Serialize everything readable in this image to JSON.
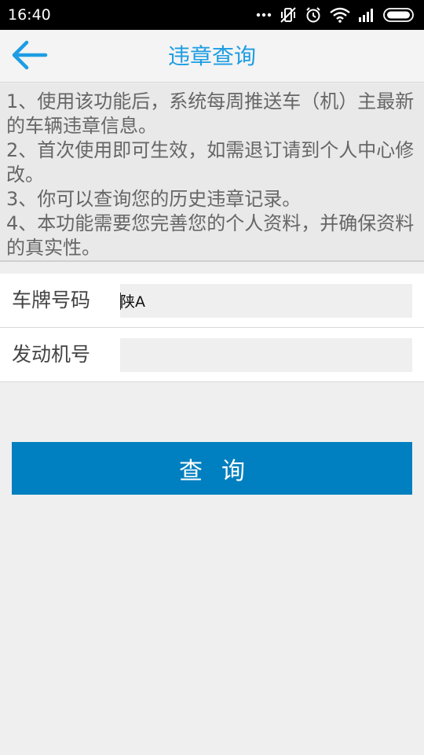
{
  "status_bar": {
    "time": "16:40",
    "icons": [
      "more-dots-icon",
      "vibrate-off-icon",
      "alarm-icon",
      "wifi-icon",
      "signal-icon",
      "battery-icon"
    ]
  },
  "header": {
    "title": "违章查询",
    "back_icon": "arrow-left-icon"
  },
  "notice": {
    "lines": [
      "1、使用该功能后，系统每周推送车（机）主最新的车辆违章信息。",
      " 2、首次使用即可生效，如需退订请到个人中心修改。",
      " 3、你可以查询您的历史违章记录。",
      " 4、本功能需要您完善您的个人资料，并确保资料的真实性。"
    ]
  },
  "form": {
    "plate_label": "车牌号码",
    "plate_value": "陕A",
    "engine_label": "发动机号",
    "engine_value": ""
  },
  "actions": {
    "query_label": "查询"
  },
  "colors": {
    "accent": "#1d9de3",
    "button": "#0080c0",
    "background": "#efefef"
  }
}
